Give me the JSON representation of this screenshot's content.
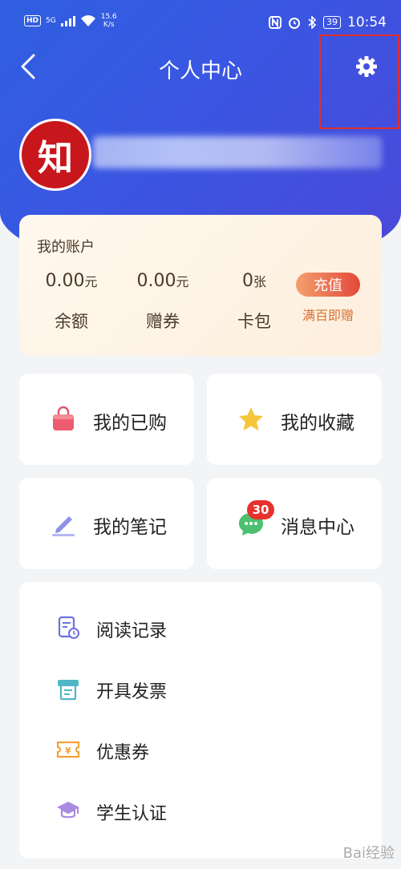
{
  "status_bar": {
    "network_speed_value": "15.6",
    "network_speed_unit": "K/s",
    "hd_label": "HD",
    "signal_label": "5G",
    "battery": "39",
    "time": "10:54"
  },
  "nav": {
    "title": "个人中心",
    "back_icon": "chevron-left-icon",
    "settings_icon": "gear-icon"
  },
  "profile": {
    "avatar_text": "知"
  },
  "account": {
    "title": "我的账户",
    "balance": {
      "value": "0.00",
      "unit": "元",
      "label": "余额"
    },
    "coupon": {
      "value": "0.00",
      "unit": "元",
      "label": "赠券"
    },
    "cards": {
      "value": "0",
      "unit": "张",
      "label": "卡包"
    },
    "recharge_label": "充值",
    "recharge_sub": "满百即赠"
  },
  "tiles": {
    "purchased": {
      "label": "我的已购",
      "icon": "shopping-bag-icon"
    },
    "favorites": {
      "label": "我的收藏",
      "icon": "star-icon"
    },
    "notes": {
      "label": "我的笔记",
      "icon": "pen-icon"
    },
    "messages": {
      "label": "消息中心",
      "icon": "chat-icon",
      "badge": "30"
    }
  },
  "menu": [
    {
      "label": "阅读记录",
      "icon": "reading-history-icon"
    },
    {
      "label": "开具发票",
      "icon": "invoice-icon"
    },
    {
      "label": "优惠券",
      "icon": "coupon-icon"
    },
    {
      "label": "学生认证",
      "icon": "graduation-cap-icon"
    }
  ],
  "watermark": "Bai经验"
}
